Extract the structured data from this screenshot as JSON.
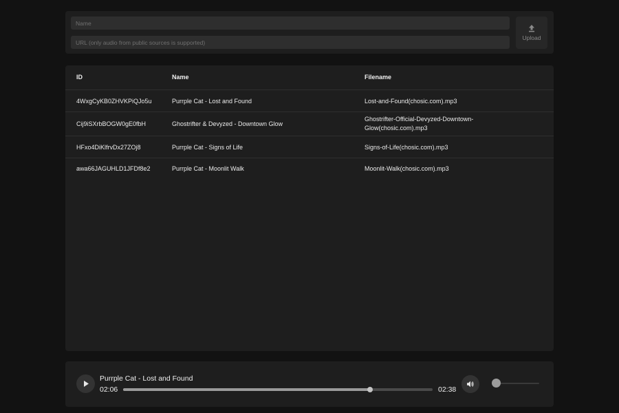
{
  "upload": {
    "name_placeholder": "Name",
    "url_placeholder": "URL (only audio from public sources is supported)",
    "upload_label": "Upload",
    "upload_icon": "upload-icon"
  },
  "table": {
    "headers": {
      "id": "ID",
      "name": "Name",
      "filename": "Filename"
    },
    "rows": [
      {
        "id": "4WxgCyKB0ZHVKPiQJo5u",
        "name": "Purrple Cat - Lost and Found",
        "filename": "Lost-and-Found(chosic.com).mp3"
      },
      {
        "id": "Cij9iSXrbBOGW0gE0fbH",
        "name": "Ghostrifter & Devyzed - Downtown Glow",
        "filename": "Ghostrifter-Official-Devyzed-Downtown-Glow(chosic.com).mp3"
      },
      {
        "id": "HFxo4DiKlfrvDx27ZOj8",
        "name": "Purrple Cat - Signs of Life",
        "filename": "Signs-of-Life(chosic.com).mp3"
      },
      {
        "id": "awa66JAGUHLD1JFDf8e2",
        "name": "Purrple Cat - Moonlit Walk",
        "filename": "Moonlit-Walk(chosic.com).mp3"
      }
    ]
  },
  "player": {
    "title": "Purrple Cat - Lost and Found",
    "current_time": "02:06",
    "total_time": "02:38",
    "progress": 0.798,
    "volume": 0.03,
    "play_icon": "play-icon",
    "volume_icon": "volume-icon"
  },
  "colors": {
    "background": "#121212",
    "panel": "#1e1e1e",
    "field": "#2e2e2e"
  }
}
